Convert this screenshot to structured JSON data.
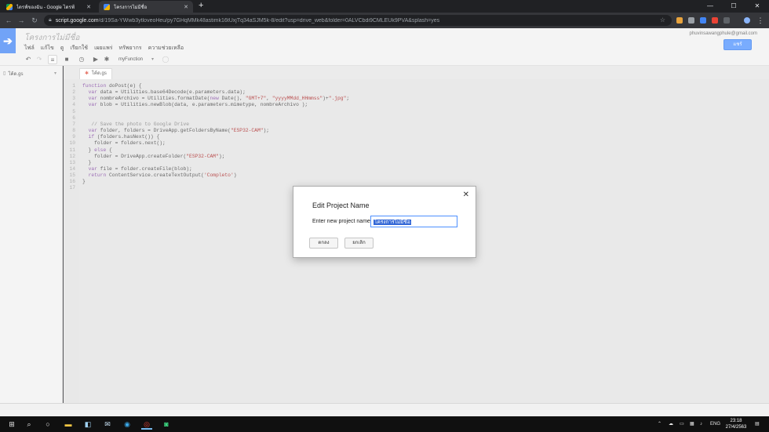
{
  "browser": {
    "tabs": [
      {
        "title": "ไดรฟ์ของฉัน - Google ไดรฟ์",
        "icon": "google-drive-icon"
      },
      {
        "title": "โครงการไม่มีชื่อ",
        "icon": "apps-script-icon"
      }
    ],
    "new_tab": "+",
    "url_host": "script.google.com",
    "url_path": "/d/19Sa-YWwb3ytloveoHeu/py7GHqMMk48astimk16tUxjTq34aSJM5k-8/edit?usp=drive_web&folder=0ALVCbdi9CMLEUk9PVA&splash=yes",
    "window_controls": {
      "minimize": "—",
      "maximize": "☐",
      "close": "✕"
    }
  },
  "app": {
    "project_title": "โครงการไม่มีชื่อ",
    "account_email": "phuvinsawangphule@gmail.com",
    "deploy_label": "แชร์",
    "menu": [
      "ไฟล์",
      "แก้ไข",
      "ดู",
      "เรียกใช้",
      "เผยแพร่",
      "ทรัพยากร",
      "ความช่วยเหลือ"
    ],
    "function_select": "myFunction",
    "files": [
      {
        "name": "โค้ด.gs"
      }
    ],
    "open_tab": "โค้ด.gs"
  },
  "code": [
    {
      "n": "1",
      "text": "function doPost(e) {"
    },
    {
      "n": "2",
      "text": "  var data = Utilities.base64Decode(e.parameters.data);"
    },
    {
      "n": "3",
      "text": "  var nombreArchivo = Utilities.formatDate(new Date(), \"GMT+7\", \"yyyyMMdd_HHmmss\")+\".jpg\";"
    },
    {
      "n": "4",
      "text": "  var blob = Utilities.newBlob(data, e.parameters.mimetype, nombreArchivo );"
    },
    {
      "n": "5",
      "text": ""
    },
    {
      "n": "6",
      "text": ""
    },
    {
      "n": "7",
      "text": "   // Save the photo to Google Drive"
    },
    {
      "n": "8",
      "text": "  var folder, folders = DriveApp.getFoldersByName(\"ESP32-CAM\");"
    },
    {
      "n": "9",
      "text": "  if (folders.hasNext()) {"
    },
    {
      "n": "10",
      "text": "    folder = folders.next();"
    },
    {
      "n": "11",
      "text": "  } else {"
    },
    {
      "n": "12",
      "text": "    folder = DriveApp.createFolder(\"ESP32-CAM\");"
    },
    {
      "n": "13",
      "text": "  }"
    },
    {
      "n": "14",
      "text": "  var file = folder.createFile(blob);"
    },
    {
      "n": "15",
      "text": "  return ContentService.createTextOutput('Completo')"
    },
    {
      "n": "16",
      "text": "}"
    },
    {
      "n": "17",
      "text": ""
    }
  ],
  "dialog": {
    "title": "Edit Project Name",
    "label": "Enter new project name",
    "input_value": "โครงการไม่มีชื่อ",
    "ok_label": "ตกลง",
    "cancel_label": "ยกเลิก",
    "close_glyph": "✕"
  },
  "taskbar": {
    "language": "ENG",
    "time": "23:18",
    "date": "27/4/2563"
  },
  "colors": {
    "accent": "#4d90fe",
    "selection": "#3367d6",
    "logo": "#4285f4"
  }
}
